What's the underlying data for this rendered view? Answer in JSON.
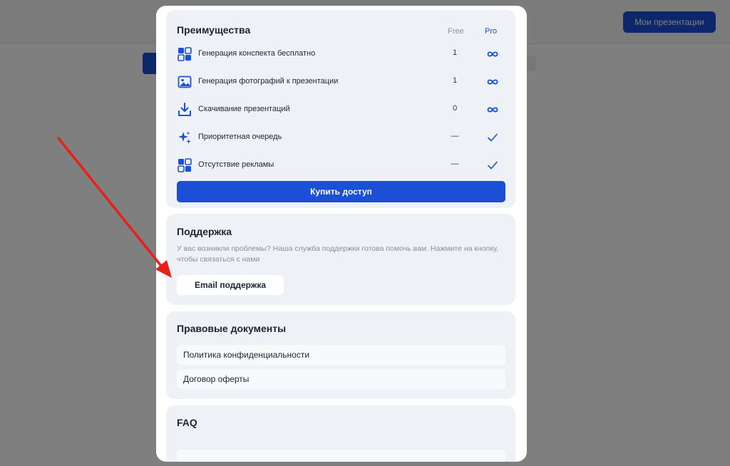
{
  "background": {
    "header_button_label": "Мои презентации"
  },
  "benefits": {
    "title": "Преимущества",
    "col_free": "Free",
    "col_pro": "Pro",
    "rows": [
      {
        "label": "Генерация конспекта бесплатно",
        "free": "1",
        "pro": "∞",
        "icon": "grid-icon"
      },
      {
        "label": "Генерация фотографий к презентации",
        "free": "1",
        "pro": "∞",
        "icon": "image-icon"
      },
      {
        "label": "Скачивание презентаций",
        "free": "0",
        "pro": "∞",
        "icon": "download-icon"
      },
      {
        "label": "Приоритетная очередь",
        "free": "—",
        "pro": "check",
        "icon": "sparkle-icon"
      },
      {
        "label": "Отсутствие рекламы",
        "free": "—",
        "pro": "check",
        "icon": "grid-icon"
      }
    ],
    "buy_label": "Купить доступ"
  },
  "support": {
    "title": "Поддержка",
    "text": "У вас возникли проблемы? Наша служба поддержки готова помочь вам. Нажмите на кнопку, чтобы связаться с нами",
    "email_label": "Email поддержка"
  },
  "legal": {
    "title": "Правовые документы",
    "items": [
      "Политика конфиденциальности",
      "Договор оферты"
    ]
  },
  "faq": {
    "title": "FAQ"
  },
  "colors": {
    "accent": "#1a4fd6",
    "annotation_arrow": "#e8201a"
  }
}
